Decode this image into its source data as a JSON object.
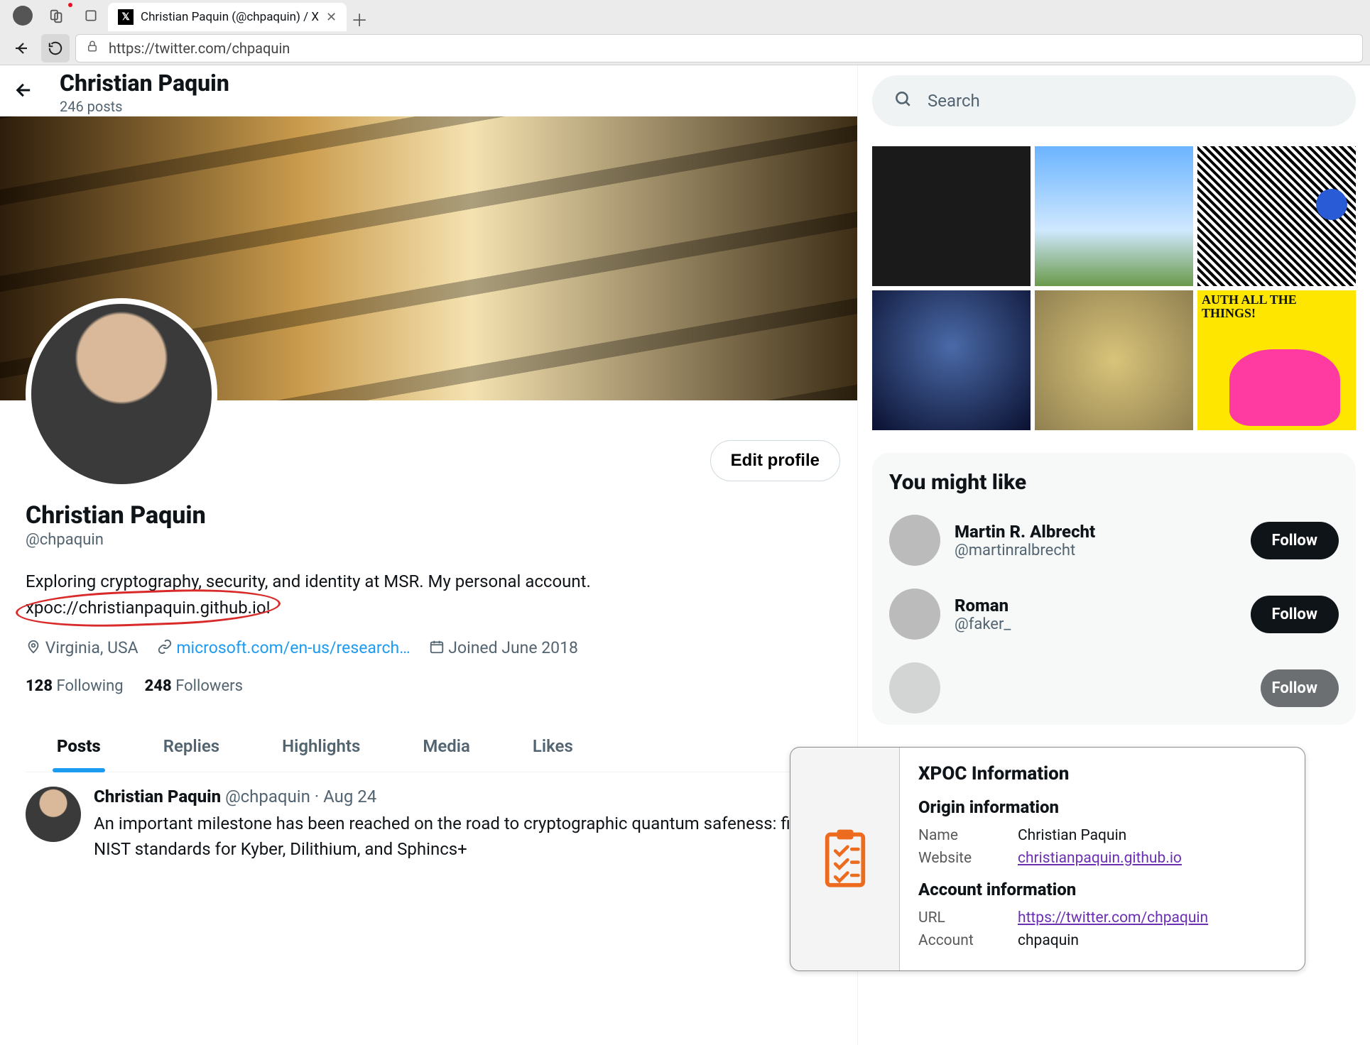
{
  "browser": {
    "tab_title": "Christian Paquin (@chpaquin) / X",
    "url": "https://twitter.com/chpaquin"
  },
  "header": {
    "name": "Christian Paquin",
    "posts": "246 posts"
  },
  "profile": {
    "edit_label": "Edit profile",
    "display_name": "Christian Paquin",
    "handle": "@chpaquin",
    "bio_line1": "Exploring cryptography, security, and identity at MSR. My personal account.",
    "bio_xpoc": "xpoc://christianpaquin.github.io!",
    "location": "Virginia, USA",
    "website": "microsoft.com/en-us/research…",
    "joined": "Joined June 2018",
    "following_n": "128",
    "following_l": "Following",
    "followers_n": "248",
    "followers_l": "Followers"
  },
  "tabs": {
    "posts": "Posts",
    "replies": "Replies",
    "highlights": "Highlights",
    "media": "Media",
    "likes": "Likes"
  },
  "tweet": {
    "name": "Christian Paquin",
    "handle": "@chpaquin",
    "date": "Aug 24",
    "body": "An important milestone has been reached on the road to cryptographic quantum safeness: first NIST standards for Kyber, Dilithium, and Sphincs+"
  },
  "search": {
    "placeholder": "Search"
  },
  "yml": {
    "title": "You might like",
    "s1_name": "Martin R. Albrecht",
    "s1_handle": "@martinralbrecht",
    "s2_name": "Roman",
    "s2_handle": "@faker_",
    "follow": "Follow"
  },
  "xpoc": {
    "title": "XPOC Information",
    "origin_h": "Origin information",
    "name_k": "Name",
    "name_v": "Christian Paquin",
    "site_k": "Website",
    "site_v": "christianpaquin.github.io",
    "acct_h": "Account information",
    "url_k": "URL",
    "url_v": "https://twitter.com/chpaquin",
    "acct_k": "Account",
    "acct_v": "chpaquin"
  }
}
